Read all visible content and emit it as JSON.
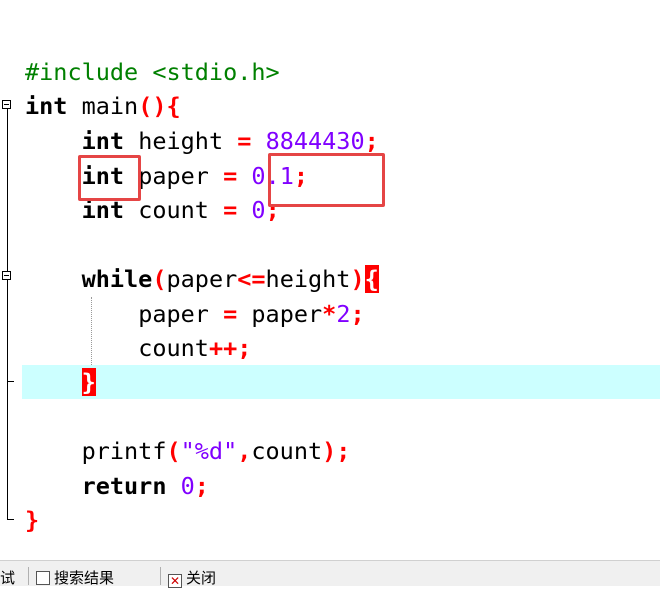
{
  "code": {
    "include_keyword": "#include",
    "include_header": "<stdio.h>",
    "main_return_type": "int",
    "main_name": "main",
    "line3": {
      "type": "int",
      "name": "height",
      "op": "=",
      "value": "8844430",
      "end": ";"
    },
    "line4": {
      "type": "int",
      "name": "paper",
      "op": "=",
      "value": "0.1",
      "end": ";"
    },
    "line5": {
      "type": "int",
      "name": "count",
      "op": "=",
      "value": "0",
      "end": ";"
    },
    "while_keyword": "while",
    "while_cond_left": "paper",
    "while_cond_op": "<=",
    "while_cond_right": "height",
    "body1": {
      "name": "paper",
      "op": "=",
      "expr_var": "paper",
      "mul": "*",
      "factor": "2",
      "end": ";"
    },
    "body2": {
      "name": "count",
      "op": "++",
      "end": ";"
    },
    "printf_name": "printf",
    "printf_format": "\"%d\"",
    "printf_arg": "count",
    "return_keyword": "return",
    "return_value": "0"
  },
  "bottom_tabs": {
    "tab1_label": "试",
    "tab2_label": "搜索结果",
    "tab3_label": "关闭"
  },
  "colors": {
    "keyword": "#000000",
    "preprocessor": "#008000",
    "number": "#8000ff",
    "operator": "#ff0000",
    "current_line": "#ccffff",
    "annotation_box": "#e54545"
  }
}
